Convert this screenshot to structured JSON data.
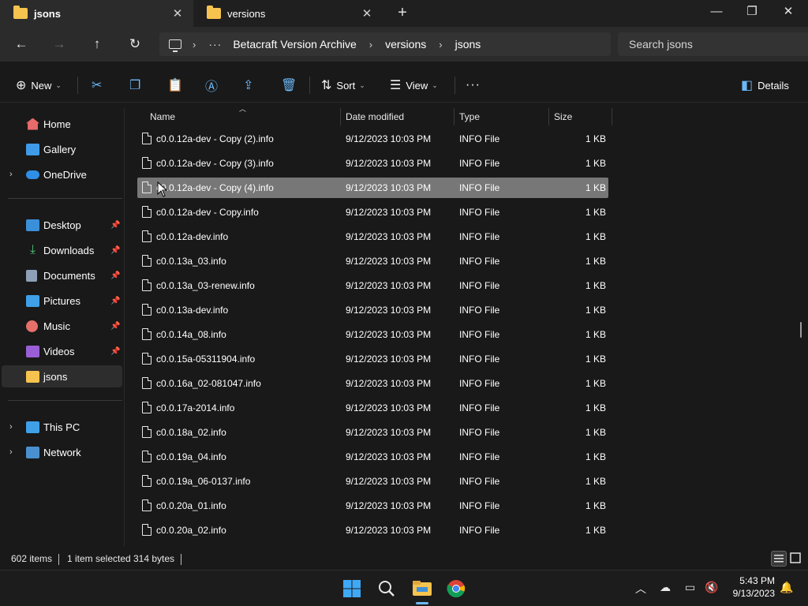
{
  "tabs": [
    {
      "label": "jsons",
      "active": true
    },
    {
      "label": "versions",
      "active": false
    }
  ],
  "window_controls": {
    "minimize": "—",
    "maximize": "❐",
    "close": "✕"
  },
  "address": {
    "overflow": "···",
    "crumbs": [
      "Betacraft Version Archive",
      "versions",
      "jsons"
    ],
    "separator": "›"
  },
  "search": {
    "placeholder": "Search jsons"
  },
  "commands": {
    "new_label": "New",
    "sort_label": "Sort",
    "view_label": "View",
    "more": "···",
    "details_label": "Details"
  },
  "nav": {
    "home": "Home",
    "gallery": "Gallery",
    "onedrive": "OneDrive",
    "desktop": "Desktop",
    "downloads": "Downloads",
    "documents": "Documents",
    "pictures": "Pictures",
    "music": "Music",
    "videos": "Videos",
    "jsons": "jsons",
    "thispc": "This PC",
    "network": "Network"
  },
  "columns": {
    "name": "Name",
    "date": "Date modified",
    "type": "Type",
    "size": "Size"
  },
  "files": [
    {
      "name": "c0.0.12a-dev - Copy (2).info",
      "date": "9/12/2023 10:03 PM",
      "type": "INFO File",
      "size": "1 KB"
    },
    {
      "name": "c0.0.12a-dev - Copy (3).info",
      "date": "9/12/2023 10:03 PM",
      "type": "INFO File",
      "size": "1 KB"
    },
    {
      "name": "c0.0.12a-dev - Copy (4).info",
      "date": "9/12/2023 10:03 PM",
      "type": "INFO File",
      "size": "1 KB"
    },
    {
      "name": "c0.0.12a-dev - Copy.info",
      "date": "9/12/2023 10:03 PM",
      "type": "INFO File",
      "size": "1 KB"
    },
    {
      "name": "c0.0.12a-dev.info",
      "date": "9/12/2023 10:03 PM",
      "type": "INFO File",
      "size": "1 KB"
    },
    {
      "name": "c0.0.13a_03.info",
      "date": "9/12/2023 10:03 PM",
      "type": "INFO File",
      "size": "1 KB"
    },
    {
      "name": "c0.0.13a_03-renew.info",
      "date": "9/12/2023 10:03 PM",
      "type": "INFO File",
      "size": "1 KB"
    },
    {
      "name": "c0.0.13a-dev.info",
      "date": "9/12/2023 10:03 PM",
      "type": "INFO File",
      "size": "1 KB"
    },
    {
      "name": "c0.0.14a_08.info",
      "date": "9/12/2023 10:03 PM",
      "type": "INFO File",
      "size": "1 KB"
    },
    {
      "name": "c0.0.15a-05311904.info",
      "date": "9/12/2023 10:03 PM",
      "type": "INFO File",
      "size": "1 KB"
    },
    {
      "name": "c0.0.16a_02-081047.info",
      "date": "9/12/2023 10:03 PM",
      "type": "INFO File",
      "size": "1 KB"
    },
    {
      "name": "c0.0.17a-2014.info",
      "date": "9/12/2023 10:03 PM",
      "type": "INFO File",
      "size": "1 KB"
    },
    {
      "name": "c0.0.18a_02.info",
      "date": "9/12/2023 10:03 PM",
      "type": "INFO File",
      "size": "1 KB"
    },
    {
      "name": "c0.0.19a_04.info",
      "date": "9/12/2023 10:03 PM",
      "type": "INFO File",
      "size": "1 KB"
    },
    {
      "name": "c0.0.19a_06-0137.info",
      "date": "9/12/2023 10:03 PM",
      "type": "INFO File",
      "size": "1 KB"
    },
    {
      "name": "c0.0.20a_01.info",
      "date": "9/12/2023 10:03 PM",
      "type": "INFO File",
      "size": "1 KB"
    },
    {
      "name": "c0.0.20a_02.info",
      "date": "9/12/2023 10:03 PM",
      "type": "INFO File",
      "size": "1 KB"
    }
  ],
  "selected_index": 2,
  "status": {
    "items": "602 items",
    "selected": "1 item selected",
    "bytes": "314 bytes"
  },
  "clock": {
    "time": "5:43 PM",
    "date": "9/13/2023"
  },
  "colors": {
    "accent": "#6cb8f6",
    "folder": "#f6c34f",
    "selection": "#777777"
  }
}
